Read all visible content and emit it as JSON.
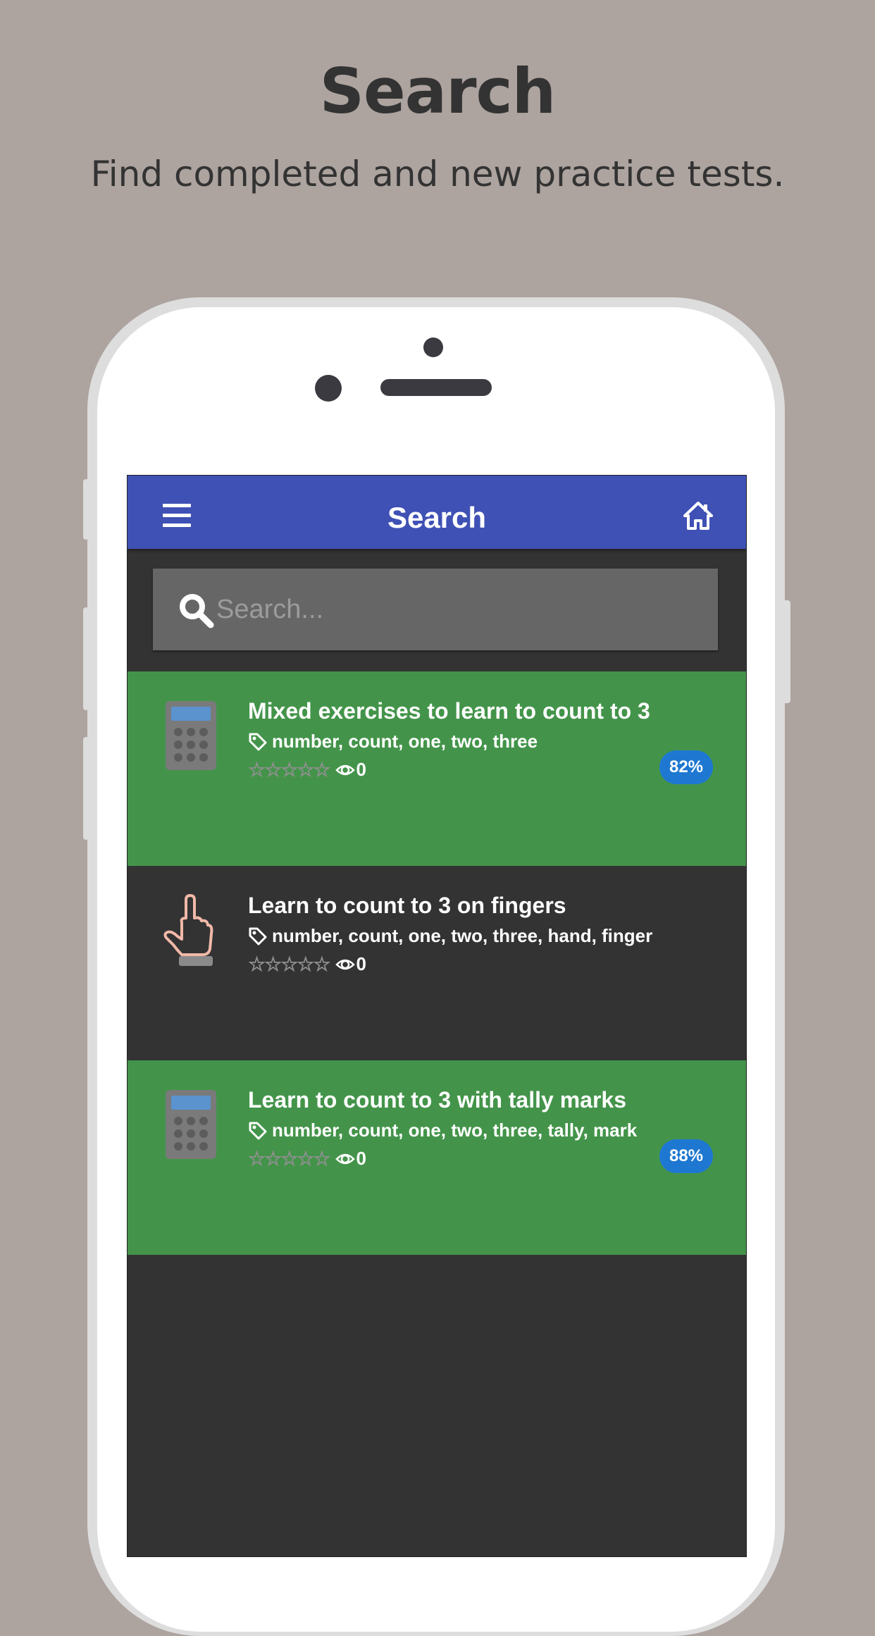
{
  "promo": {
    "title": "Search",
    "subtitle": "Find completed and new practice tests."
  },
  "app": {
    "appbar_title": "Search",
    "menu_icon": "hamburger-menu-icon",
    "home_icon": "home-icon",
    "colors": {
      "appbar": "#3f51b5",
      "screen_bg": "#333333",
      "completed_item": "#43944a",
      "badge": "#1e78d2"
    }
  },
  "search": {
    "placeholder": "Search...",
    "value": "",
    "icon": "search-icon"
  },
  "items": [
    {
      "title": "Mixed exercises to learn to count to 3",
      "tags": "number, count, one, two, three",
      "stars": "☆☆☆☆☆",
      "rating": 0,
      "views": "0",
      "score": "82%",
      "icon": "calculator-icon",
      "status": "completed"
    },
    {
      "title": "Learn to count to 3 on fingers",
      "tags": "number, count, one, two, three, hand, finger",
      "stars": "☆☆☆☆☆",
      "rating": 0,
      "views": "0",
      "score": "",
      "icon": "hand-pointing-icon",
      "status": "new"
    },
    {
      "title": "Learn to count to 3 with tally marks",
      "tags": "number, count, one, two, three, tally, mark",
      "stars": "☆☆☆☆☆",
      "rating": 0,
      "views": "0",
      "score": "88%",
      "icon": "calculator-icon",
      "status": "completed"
    }
  ]
}
